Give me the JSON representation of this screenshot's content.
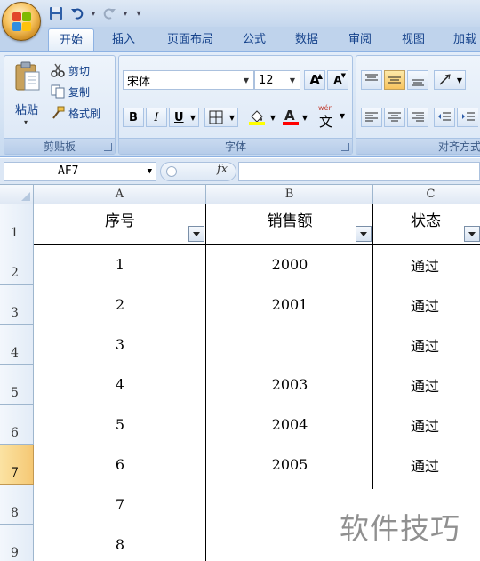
{
  "quick_access": {
    "undo_icon": "undo-icon",
    "redo_icon": "redo-icon",
    "customize": "▾"
  },
  "tabs": [
    "开始",
    "插入",
    "页面布局",
    "公式",
    "数据",
    "审阅",
    "视图",
    "加载"
  ],
  "active_tab": "开始",
  "clipboard": {
    "paste": "粘贴",
    "cut": "剪切",
    "copy": "复制",
    "format_painter": "格式刷",
    "label": "剪贴板"
  },
  "font": {
    "name": "宋体",
    "size": "12",
    "grow_label": "A",
    "shrink_label": "A",
    "bold": "B",
    "italic": "I",
    "underline": "U",
    "font_color_letter": "A",
    "phonetic": "文",
    "phonetic_small": "wén",
    "label": "字体"
  },
  "alignment": {
    "label": "对齐方式"
  },
  "colors": {
    "fill_yellow": "#ffff00",
    "font_red": "#ff0000",
    "selected_row": "#f5c874"
  },
  "formula_bar": {
    "name_box": "AF7",
    "fx": "fx",
    "formula": ""
  },
  "sheet": {
    "columns": [
      "A",
      "B",
      "C"
    ],
    "row_numbers": [
      "1",
      "2",
      "3",
      "4",
      "5",
      "6",
      "7",
      "8",
      "9"
    ],
    "selected_row": "7",
    "headers": [
      "序号",
      "销售额",
      "状态"
    ],
    "rows": [
      [
        "1",
        "2000",
        "通过"
      ],
      [
        "2",
        "2001",
        "通过"
      ],
      [
        "3",
        "",
        "通过"
      ],
      [
        "4",
        "2003",
        "通过"
      ],
      [
        "5",
        "2004",
        "通过"
      ],
      [
        "6",
        "2005",
        "通过"
      ],
      [
        "7",
        "",
        ""
      ],
      [
        "8",
        "",
        ""
      ]
    ]
  },
  "watermark": "软件技巧"
}
